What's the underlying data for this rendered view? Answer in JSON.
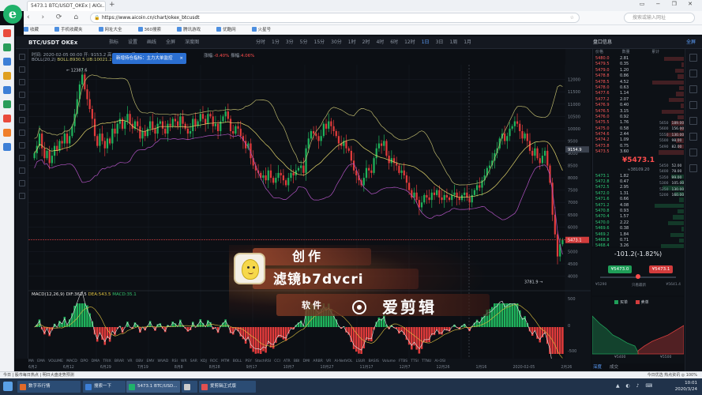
{
  "browser": {
    "tab_title": "5473.1 BTC/USDT_OKEx | AIC...",
    "tab_close": "×",
    "new_tab": "+",
    "url_prefix": "https://",
    "url": "www.aicoin.cn/chart/okex_btcusdt",
    "search_placeholder": "搜索或输入网址",
    "bookmarks": [
      "收藏",
      "手机收藏夹",
      "网址大全",
      "360搜索",
      "腾讯游戏",
      "优酷网",
      "火星号"
    ]
  },
  "app": {
    "pair": "BTC/USDT OKEx",
    "toolbar": [
      "指标",
      "设置",
      "画线",
      "全屏",
      "深度图"
    ],
    "intervals": [
      "分时",
      "1分",
      "3分",
      "5分",
      "15分",
      "30分",
      "1时",
      "2时",
      "4时",
      "6时",
      "12时",
      "1日",
      "3日",
      "1周",
      "1月"
    ],
    "active_interval": "1日",
    "orderbook_title": "盘口信息",
    "orderbook_right": "全屏",
    "info_line1": "时间: 2020-02-05 00:00  开: 9153.2  高: 9780.0  低: 9120.0  收: 9730.1",
    "info_boll": "BOLL(20,2)",
    "info_boll_values": "BOLL:8930.5  UB:10021.2  LB:7840.0",
    "popup_text": "新增持仓指标：主力大单监控",
    "popup_close": "×",
    "gain_label_1": "涨幅:",
    "gain_value_1": "-0.40%",
    "gain_label_2": "振幅:",
    "gain_value_2": "4.06%",
    "macd_label": "MACD(12,26,9)",
    "macd_dif": "DIF:361.5",
    "macd_dea": "DEA:543.5",
    "macd_val": "MACD:35.1",
    "high_label": "12387.6",
    "low_label": "3781.9",
    "price_tag": "5473.1",
    "price_tag_2": "9154.9",
    "indicators": [
      "MA",
      "EMA",
      "VOLUME",
      "MACD",
      "DPO",
      "DMA",
      "TRIX",
      "BRAR",
      "VR",
      "OBV",
      "EMV",
      "WVAD",
      "RSI",
      "WR",
      "SAR",
      "KDJ",
      "ROC",
      "MTM",
      "BOLL",
      "PSY",
      "StochRSI",
      "CCI",
      "ATR",
      "BBI",
      "DMI",
      "ARBR",
      "VR",
      "AI-NetVOL",
      "LSUR",
      "BASIS",
      "Volume",
      "FTBS",
      "TTSI",
      "TTNU",
      "AI-OSI"
    ],
    "dates": [
      "6月2",
      "6月12",
      "6月29",
      "7月19",
      "8月8",
      "8月28",
      "9月17",
      "10月7",
      "10月27",
      "11月17",
      "12月7",
      "12月26",
      "1月16",
      "2020-02-05",
      "2月26"
    ],
    "bottom_tabs": [
      "深度",
      "成交"
    ],
    "bottom_tab_active": "深度"
  },
  "orderbook": {
    "header": [
      "价格",
      "数量",
      "累计"
    ],
    "asks": [
      {
        "p": "5480.0",
        "a": "2.81"
      },
      {
        "p": "5479.5",
        "a": "0.35"
      },
      {
        "p": "5479.0",
        "a": "1.20"
      },
      {
        "p": "5478.8",
        "a": "0.86"
      },
      {
        "p": "5478.5",
        "a": "4.52"
      },
      {
        "p": "5478.0",
        "a": "0.63"
      },
      {
        "p": "5477.6",
        "a": "1.14"
      },
      {
        "p": "5477.2",
        "a": "2.07"
      },
      {
        "p": "5476.9",
        "a": "0.40"
      },
      {
        "p": "5476.5",
        "a": "3.15"
      },
      {
        "p": "5476.0",
        "a": "0.92"
      },
      {
        "p": "5475.5",
        "a": "1.76"
      },
      {
        "p": "5475.0",
        "a": "0.58"
      },
      {
        "p": "5474.6",
        "a": "2.44"
      },
      {
        "p": "5474.2",
        "a": "1.09"
      },
      {
        "p": "5473.8",
        "a": "0.75"
      },
      {
        "p": "5473.5",
        "a": "3.60"
      }
    ],
    "last_price": "¥5473.1",
    "last_sub": "≈38109.20",
    "bids": [
      {
        "p": "5473.1",
        "a": "1.82"
      },
      {
        "p": "5472.8",
        "a": "0.47"
      },
      {
        "p": "5472.5",
        "a": "2.95"
      },
      {
        "p": "5472.0",
        "a": "1.31"
      },
      {
        "p": "5471.6",
        "a": "0.66"
      },
      {
        "p": "5471.2",
        "a": "4.08"
      },
      {
        "p": "5470.8",
        "a": "0.93"
      },
      {
        "p": "5470.4",
        "a": "1.57"
      },
      {
        "p": "5470.0",
        "a": "2.22"
      },
      {
        "p": "5469.6",
        "a": "0.38"
      },
      {
        "p": "5469.2",
        "a": "1.84"
      },
      {
        "p": "5468.8",
        "a": "0.71"
      },
      {
        "p": "5468.4",
        "a": "3.26"
      },
      {
        "p": "5468.0",
        "a": "1.05"
      },
      {
        "p": "5467.6",
        "a": "0.52"
      },
      {
        "p": "5467.2",
        "a": "2.68"
      },
      {
        "p": "5466.8",
        "a": "1.13"
      },
      {
        "p": "5466.4",
        "a": "0.89"
      }
    ],
    "mini_ask": [
      {
        "l": "5650",
        "v": "189.00"
      },
      {
        "l": "5600",
        "v": "156.00"
      },
      {
        "l": "5550",
        "v": "130.00"
      },
      {
        "l": "5500",
        "v": "98.00"
      },
      {
        "l": "5490",
        "v": "82.00"
      }
    ],
    "mini_bid": [
      {
        "l": "5450",
        "v": "52.00"
      },
      {
        "l": "5400",
        "v": "78.00"
      },
      {
        "l": "5350",
        "v": "99.00"
      },
      {
        "l": "5300",
        "v": "105.00"
      },
      {
        "l": "5250",
        "v": "130.00"
      },
      {
        "l": "5200",
        "v": "160.00"
      }
    ]
  },
  "ticker": {
    "change": "-101.2(-1.82%)",
    "buy_label": "¥5473.0",
    "sell_label": "¥5473.1",
    "limit_low": "¥5290",
    "limit_mid": "只看最新",
    "limit_high": "¥5641.4"
  },
  "depth": {
    "legend_buy": "买单",
    "legend_sell": "卖单",
    "label_left": "¥5400",
    "label_right": "¥5500",
    "colors": {
      "buy": "#1f9e58",
      "sell": "#d23c3c"
    }
  },
  "watermark": {
    "line1": "创作",
    "line2": "滤镜b7dvcri",
    "line3": "软件",
    "line4": "爱剪辑"
  },
  "statusbar": {
    "left": "今日 | 股市每日热点 | 明日大盘走势预测",
    "right": "今日优选   热点资讯   ◎ 100%"
  },
  "taskbar": {
    "items": [
      "数字币行情",
      "搜索一下",
      "5473.1 BTC/USD...",
      "",
      "爱剪辑正式版"
    ],
    "time": "10:01",
    "date": "2020/3/24"
  },
  "chart_data": {
    "type": "candlestick",
    "price_axis_ticks": [
      12000,
      11500,
      11000,
      10500,
      10000,
      9500,
      9000,
      8500,
      8000,
      7500,
      7000,
      6500,
      6000,
      5500,
      5000,
      4500,
      4000
    ],
    "macd_axis_ticks": [
      "500",
      "0",
      "-500"
    ],
    "ylim": [
      3600,
      12600
    ],
    "close": [
      9000,
      9300,
      9800,
      9200,
      8800,
      9100,
      8600,
      8900,
      9300,
      9100,
      9500,
      9400,
      9800,
      9400,
      9700,
      10100,
      10600,
      11200,
      11800,
      12200,
      11600,
      11200,
      10800,
      10400,
      9700,
      9300,
      9800,
      9500,
      9200,
      9600,
      9400,
      10000,
      9800,
      10200,
      10400,
      10000,
      10300,
      10600,
      10200,
      10000,
      10300,
      10100,
      9600,
      9900,
      9700,
      10000,
      10300,
      10000,
      9800,
      10200,
      10300,
      10000,
      9800,
      10200,
      10100,
      10400,
      10300,
      10100,
      10500,
      10200,
      10000,
      9800,
      9900,
      10400,
      10100,
      10300,
      10600,
      10400,
      10200,
      10600,
      10500,
      10100,
      10200,
      9900,
      10300,
      10500,
      10700,
      10400,
      9900,
      9800,
      10100,
      10000,
      9700,
      9500,
      9200,
      9400,
      8800,
      8500,
      8300,
      8200,
      8000,
      8100,
      7900,
      8300,
      8000,
      7800,
      8000,
      8200,
      8100,
      7900,
      7700,
      8000,
      8200,
      8100,
      8300,
      8400,
      8500,
      8200,
      9200,
      9600,
      9900,
      9800,
      9700,
      9500,
      9700,
      10200,
      10000,
      10300,
      10100,
      9900,
      9700,
      9400,
      9300,
      9500,
      9200,
      9100,
      8700,
      8300,
      8100,
      7900,
      7700,
      8000,
      8400,
      8300,
      8200,
      8800,
      9200,
      9400,
      9300,
      9500,
      8900,
      8600,
      8800,
      8600,
      8500,
      8200,
      8300,
      8100,
      7800,
      7500,
      7200,
      7400,
      7100,
      6800,
      7000,
      7300,
      7200,
      7100,
      7400,
      7300,
      7500,
      7200,
      7100,
      7300,
      7200,
      7100,
      7300,
      7400,
      7200,
      7100,
      7300,
      7400,
      7200,
      7000,
      7300,
      7500,
      7700,
      7600,
      7900,
      8100,
      8400,
      8500,
      8700,
      9000,
      9200,
      9600,
      9800,
      9500,
      9700,
      10000,
      10100,
      10300,
      10200,
      9900,
      9600,
      9800,
      9500,
      9100,
      8900,
      9200,
      8800,
      8600,
      8900,
      9100,
      8500,
      7800,
      6500,
      5700,
      4800,
      5300,
      5473
    ]
  }
}
